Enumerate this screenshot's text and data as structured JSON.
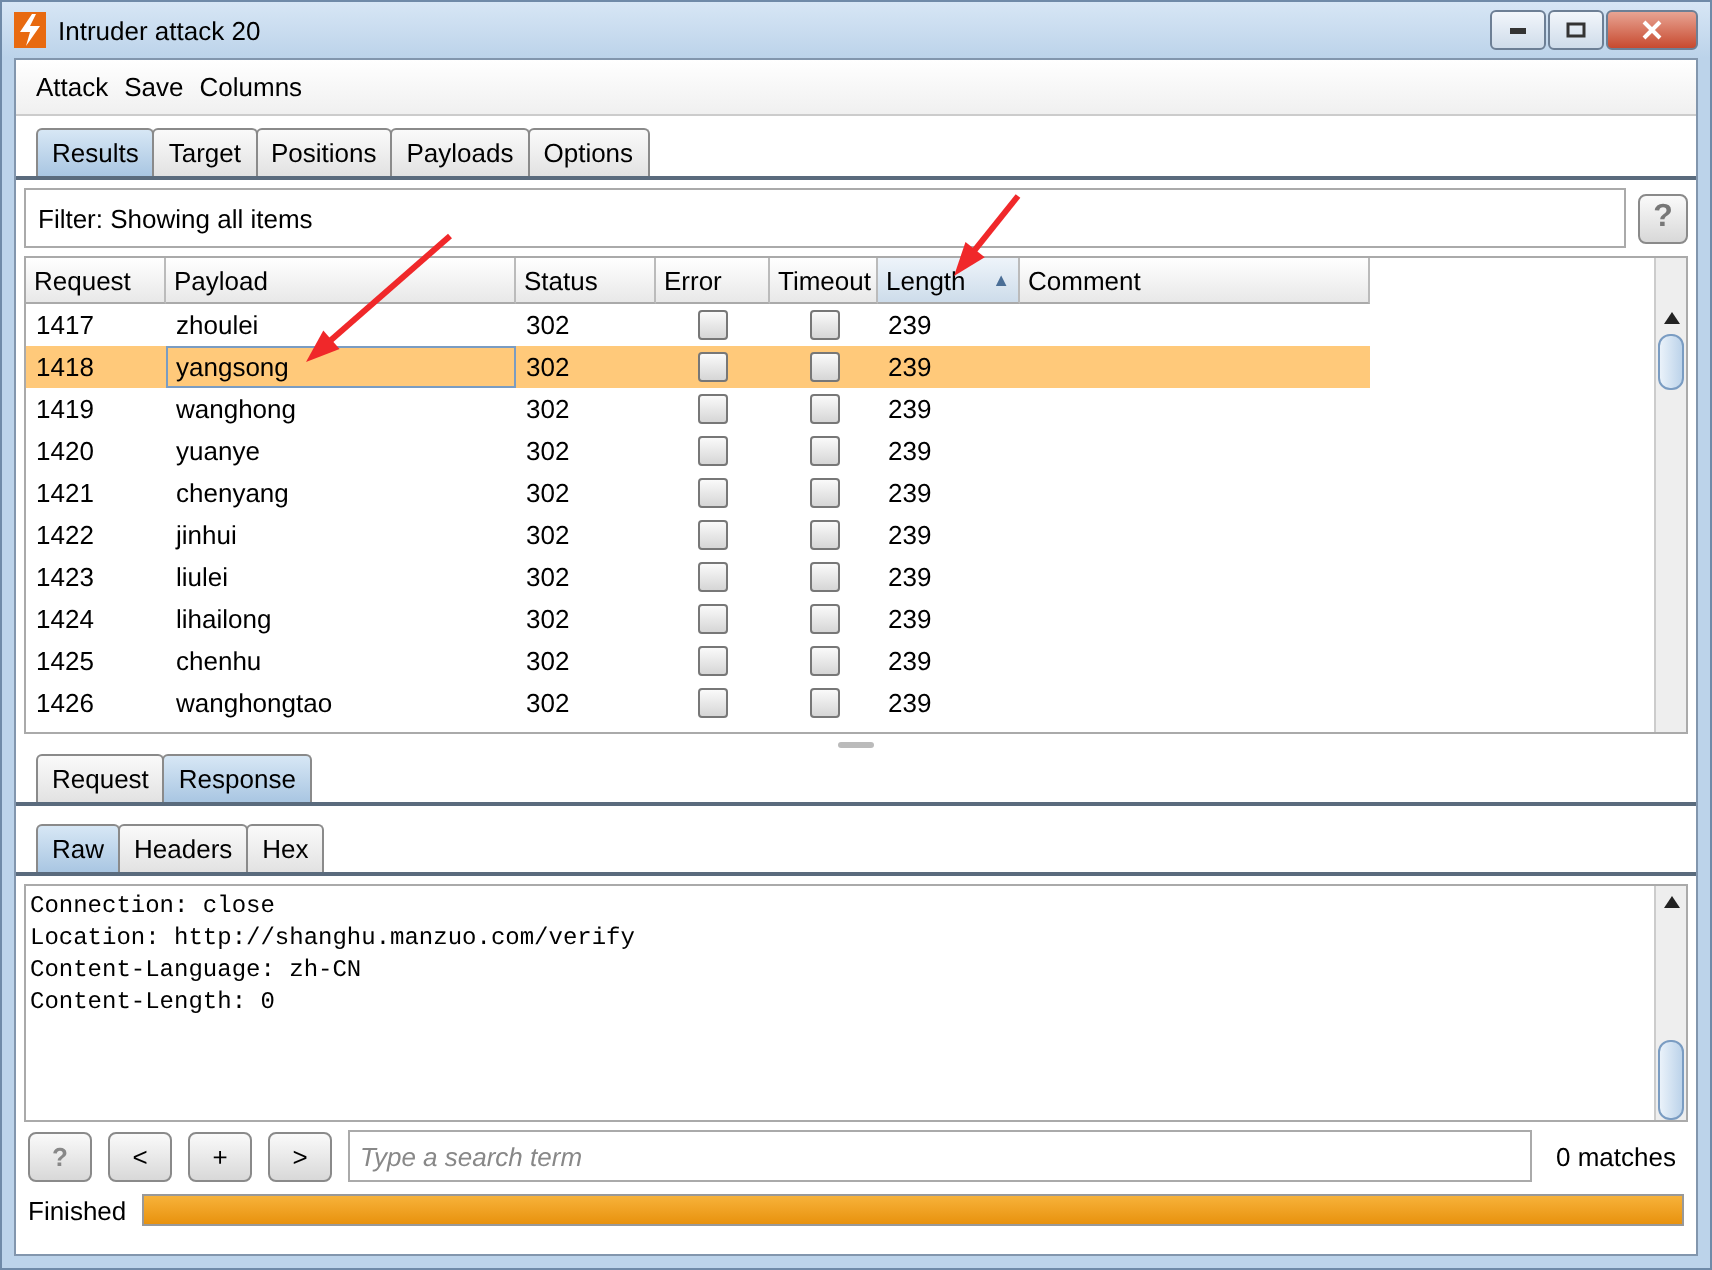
{
  "window": {
    "title": "Intruder attack 20"
  },
  "menu": [
    "Attack",
    "Save",
    "Columns"
  ],
  "tabs": [
    {
      "label": "Results",
      "selected": true
    },
    {
      "label": "Target",
      "selected": false
    },
    {
      "label": "Positions",
      "selected": false
    },
    {
      "label": "Payloads",
      "selected": false
    },
    {
      "label": "Options",
      "selected": false
    }
  ],
  "filter": {
    "text": "Filter: Showing all items",
    "help": "?"
  },
  "table": {
    "columns": [
      {
        "label": "Request",
        "sorted": false
      },
      {
        "label": "Payload",
        "sorted": false
      },
      {
        "label": "Status",
        "sorted": false
      },
      {
        "label": "Error",
        "sorted": false
      },
      {
        "label": "Timeout",
        "sorted": false
      },
      {
        "label": "Length",
        "sorted": true,
        "sort_icon": "▲"
      },
      {
        "label": "Comment",
        "sorted": false
      }
    ],
    "rows": [
      {
        "request": "1417",
        "payload": "zhoulei",
        "status": "302",
        "error": false,
        "timeout": false,
        "length": "239",
        "selected": false
      },
      {
        "request": "1418",
        "payload": "yangsong",
        "status": "302",
        "error": false,
        "timeout": false,
        "length": "239",
        "selected": true
      },
      {
        "request": "1419",
        "payload": "wanghong",
        "status": "302",
        "error": false,
        "timeout": false,
        "length": "239",
        "selected": false
      },
      {
        "request": "1420",
        "payload": "yuanye",
        "status": "302",
        "error": false,
        "timeout": false,
        "length": "239",
        "selected": false
      },
      {
        "request": "1421",
        "payload": "chenyang",
        "status": "302",
        "error": false,
        "timeout": false,
        "length": "239",
        "selected": false
      },
      {
        "request": "1422",
        "payload": "jinhui",
        "status": "302",
        "error": false,
        "timeout": false,
        "length": "239",
        "selected": false
      },
      {
        "request": "1423",
        "payload": "liulei",
        "status": "302",
        "error": false,
        "timeout": false,
        "length": "239",
        "selected": false
      },
      {
        "request": "1424",
        "payload": "lihailong",
        "status": "302",
        "error": false,
        "timeout": false,
        "length": "239",
        "selected": false
      },
      {
        "request": "1425",
        "payload": "chenhu",
        "status": "302",
        "error": false,
        "timeout": false,
        "length": "239",
        "selected": false
      },
      {
        "request": "1426",
        "payload": "wanghongtao",
        "status": "302",
        "error": false,
        "timeout": false,
        "length": "239",
        "selected": false
      }
    ]
  },
  "message_tabs": [
    {
      "label": "Request",
      "selected": false
    },
    {
      "label": "Response",
      "selected": true
    }
  ],
  "view_tabs": [
    {
      "label": "Raw",
      "selected": true
    },
    {
      "label": "Headers",
      "selected": false
    },
    {
      "label": "Hex",
      "selected": false
    }
  ],
  "response_lines": [
    "Connection: close",
    "Location: http://shanghu.manzuo.com/verify",
    "Content-Language: zh-CN",
    "Content-Length: 0"
  ],
  "search": {
    "buttons": [
      "?",
      "<",
      "+",
      ">"
    ],
    "placeholder": "Type a search term",
    "matches": "0 matches"
  },
  "status": {
    "text": "Finished",
    "level": 1
  }
}
